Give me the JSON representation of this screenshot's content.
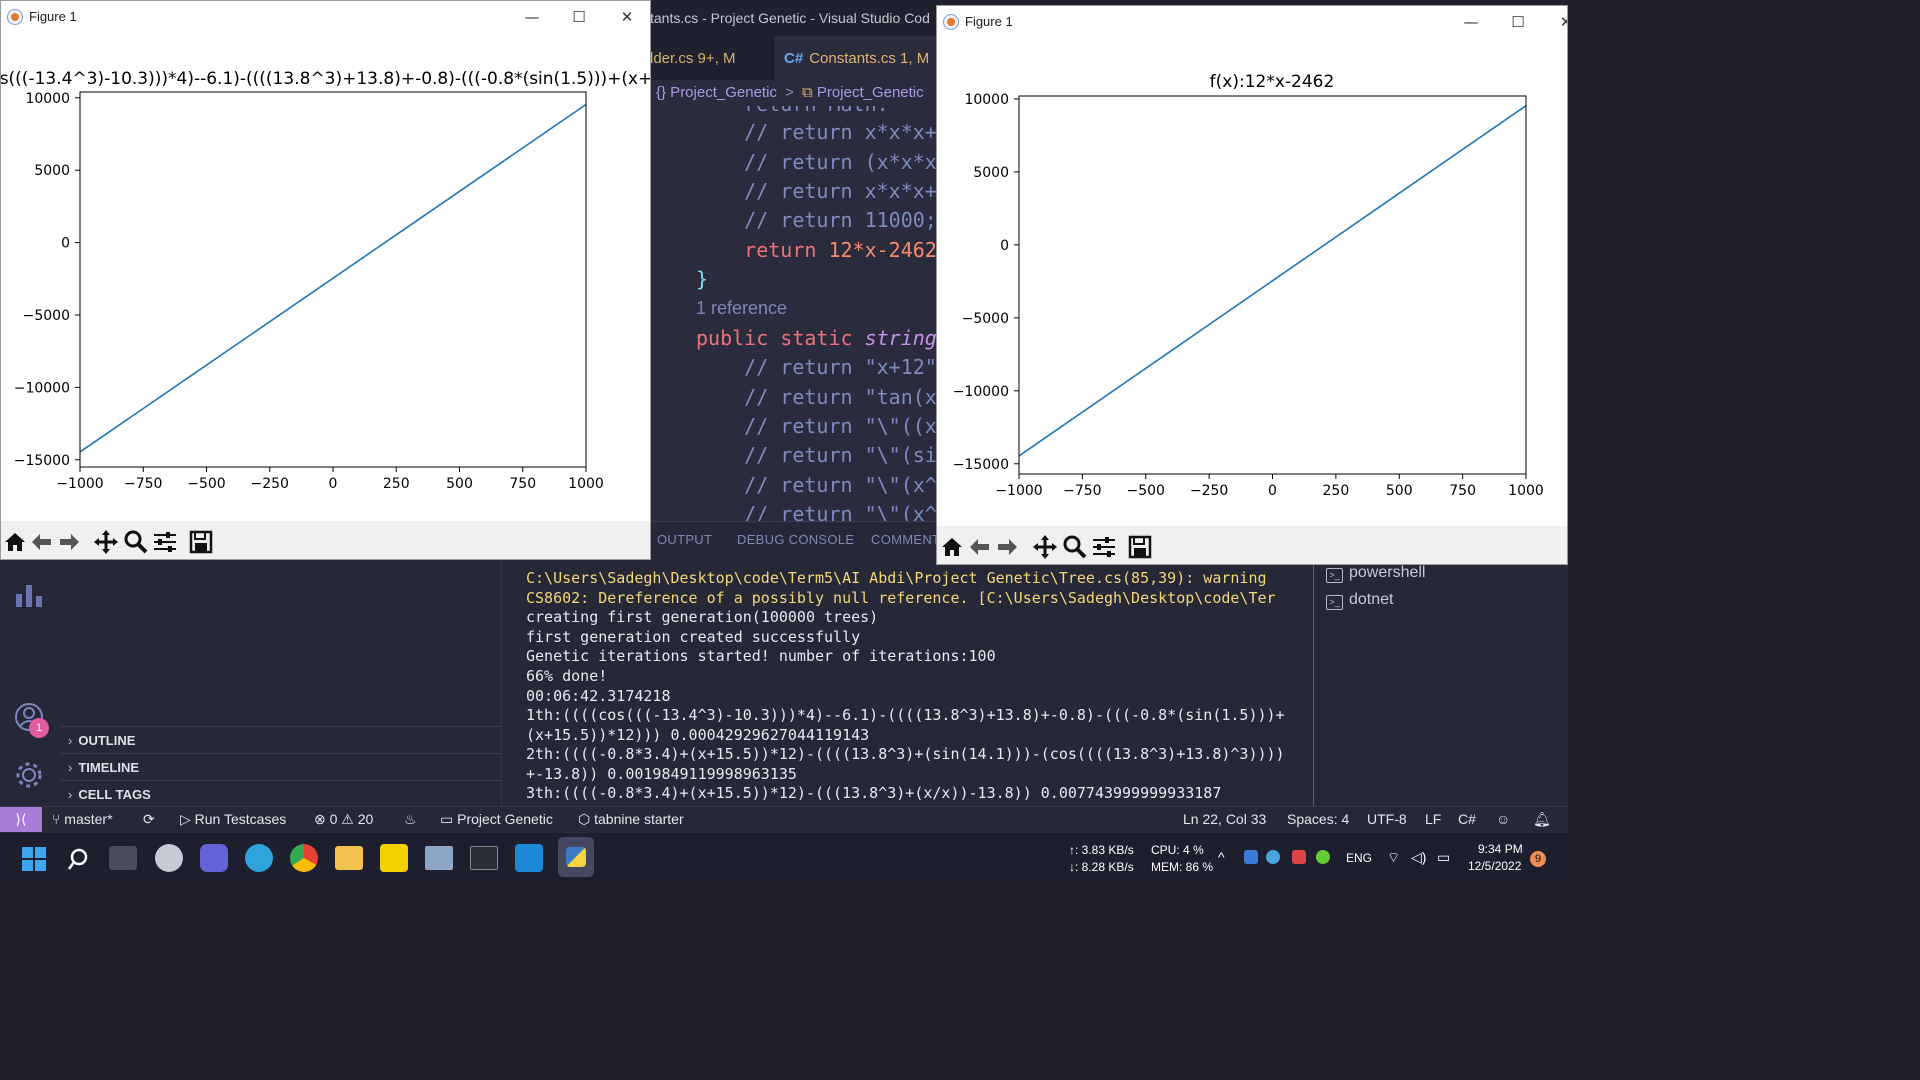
{
  "vscode": {
    "title_fragment": "tants.cs - Project Genetic - Visual Studio Cod",
    "tabs": [
      {
        "label": "lder.cs 9+, M"
      },
      {
        "icon": "C#",
        "label": "Constants.cs 1, M"
      }
    ],
    "breadcrumb": {
      "ns": "{} Project_Genetic",
      "sep": ">",
      "cls": "Project_Genetic"
    },
    "code": {
      "l0": "    return Math.",
      "l1": "    // return x*x*x+",
      "l2": "    // return (x*x*x",
      "l3": "    // return x*x*x+",
      "l4": "    // return 11000;",
      "l5_kw": "    return ",
      "l5_val": "12*x-2462",
      "l6": "}",
      "ref": "1 reference",
      "l8_kw": "public static ",
      "l8_type": "string",
      "l9": "    // return \"x+12\"",
      "l10": "    // return \"tan(x",
      "l11": "    // return \"\\\"((x",
      "l12": "    // return \"\\\"(si",
      "l13": "    // return \"\\\"(x^",
      "l14": "    // return \"\\\"(x^"
    },
    "panel_tabs": [
      "OUTPUT",
      "DEBUG CONSOLE",
      "COMMENTS"
    ],
    "sidebar_sections": [
      "OUTLINE",
      "TIMELINE",
      "CELL TAGS"
    ],
    "notification_badge": "1",
    "terminal_lines": [
      "C:\\Users\\Sadegh\\Desktop\\code\\Term5\\AI Abdi\\Project Genetic\\Tree.cs(85,39): warning",
      "CS8602: Dereference of a possibly null reference. [C:\\Users\\Sadegh\\Desktop\\code\\Ter",
      "creating first generation(100000 trees)",
      "first generation created successfully",
      "Genetic iterations started! number of iterations:100",
      "66% done!",
      "00:06:42.3174218",
      "1th:((((cos(((-13.4^3)-10.3)))*4)--6.1)-((((13.8^3)+13.8)+-0.8)-(((-0.8*(sin(1.5)))+",
      "(x+15.5))*12))) 0.00042929627044119143",
      "2th:((((-0.8*3.4)+(x+15.5))*12)-((((13.8^3)+(sin(14.1)))-(cos((((13.8^3)+13.8)^3))))",
      "+-13.8)) 0.0019849119998963135",
      "3th:((((-0.8*3.4)+(x+15.5))*12)-(((13.8^3)+(x/x))-13.8)) 0.007743999999933187"
    ],
    "terminals": [
      "powershell",
      "dotnet"
    ],
    "status": {
      "branch": "master*",
      "run": "Run Testcases",
      "errors": "0",
      "warnings": "20",
      "project": "Project Genetic",
      "tabnine": "tabnine starter",
      "position": "Ln 22, Col 33",
      "spaces": "Spaces: 4",
      "encoding": "UTF-8",
      "eol": "LF",
      "language": "C#"
    }
  },
  "figures": [
    {
      "window_title": "Figure 1",
      "plot_title": "s(((-13.4^3)-10.3)))*4)--6.1)-((((13.8^3)+13.8)+-0.8)-(((-0.8*(sin(1.5)))+(x+"
    },
    {
      "window_title": "Figure 1",
      "plot_title": "f(x):12*x-2462"
    }
  ],
  "window_controls": {
    "minimize": "—",
    "maximize": "☐",
    "close": "✕"
  },
  "chart_data": [
    {
      "type": "line",
      "title": "s(((-13.4^3)-10.3)))*4)--6.1)-((((13.8^3)+13.8)+-0.8)-(((-0.8*(sin(1.5)))+(x+",
      "xlabel": "",
      "ylabel": "",
      "xlim": [
        -1000,
        1000
      ],
      "ylim": [
        -15500,
        10400
      ],
      "xticks": [
        -1000,
        -750,
        -500,
        -250,
        0,
        250,
        500,
        750,
        1000
      ],
      "xtick_labels": [
        "−1000",
        "−750",
        "−500",
        "−250",
        "0",
        "250",
        "500",
        "750",
        "1000"
      ],
      "yticks": [
        -15000,
        -10000,
        -5000,
        0,
        5000,
        10000
      ],
      "ytick_labels": [
        "−15000",
        "−10000",
        "−5000",
        "0",
        "5000",
        "10000"
      ],
      "grid": false,
      "series": [
        {
          "x": [
            -1000,
            1000
          ],
          "y": [
            -14462,
            9538
          ],
          "color": "#1f77b4"
        }
      ]
    },
    {
      "type": "line",
      "title": "f(x):12*x-2462",
      "xlabel": "",
      "ylabel": "",
      "xlim": [
        -1000,
        1000
      ],
      "ylim": [
        -15700,
        10200
      ],
      "xticks": [
        -1000,
        -750,
        -500,
        -250,
        0,
        250,
        500,
        750,
        1000
      ],
      "xtick_labels": [
        "−1000",
        "−750",
        "−500",
        "−250",
        "0",
        "250",
        "500",
        "750",
        "1000"
      ],
      "yticks": [
        -15000,
        -10000,
        -5000,
        0,
        5000,
        10000
      ],
      "ytick_labels": [
        "−15000",
        "−10000",
        "−5000",
        "0",
        "5000",
        "10000"
      ],
      "grid": false,
      "series": [
        {
          "x": [
            -1000,
            1000
          ],
          "y": [
            -14462,
            9538
          ],
          "color": "#1f77b4"
        }
      ]
    }
  ],
  "taskbar": {
    "net_up": "↑: 3.83 KB/s",
    "net_down": "↓: 8.28 KB/s",
    "cpu": "CPU: 4 %",
    "mem": "MEM: 86 %",
    "lang": "ENG",
    "time": "9:34 PM",
    "date": "12/5/2022",
    "notif_count": "9"
  }
}
